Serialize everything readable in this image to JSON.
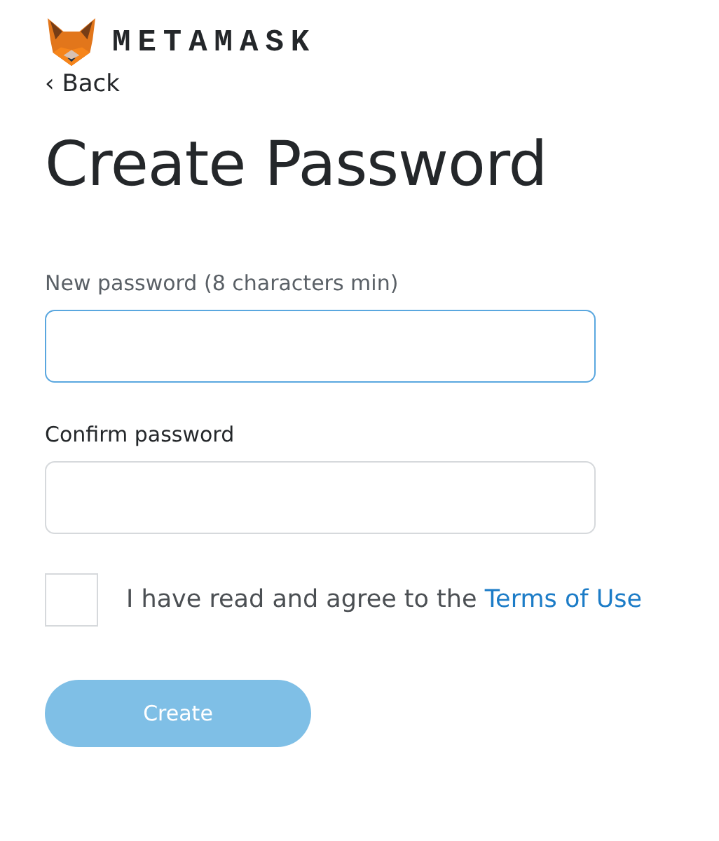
{
  "brand": {
    "name": "METAMASK"
  },
  "back_link": {
    "label": "‹ Back"
  },
  "title": "Create Password",
  "fields": [
    {
      "label": "New password (8 characters min)",
      "focused": true
    },
    {
      "label": "Confirm password",
      "focused": false
    }
  ],
  "agreement": {
    "checked": false,
    "text": "I have read and agree to the",
    "link": "Terms of Use"
  },
  "create_button": {
    "label": "Create",
    "disabled": true
  }
}
